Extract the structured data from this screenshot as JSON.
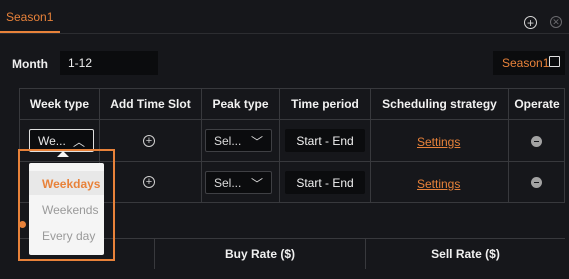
{
  "header": {
    "tab_label": "Season1"
  },
  "month": {
    "label": "Month",
    "value": "1-12"
  },
  "season_button": {
    "label": "Season1"
  },
  "table": {
    "columns": [
      "Week type",
      "Add Time Slot",
      "Peak type",
      "Time period",
      "Scheduling strategy",
      "Operate"
    ],
    "rows": [
      {
        "week_type": "We...",
        "peak_type": "Sel...",
        "time_period": "Start - End",
        "strategy": "Settings"
      },
      {
        "peak_type": "Sel...",
        "time_period": "Start - End",
        "strategy": "Settings"
      }
    ]
  },
  "dropdown": {
    "options": [
      "Weekdays",
      "Weekends",
      "Every day"
    ],
    "selected": "Weekdays"
  },
  "rates": {
    "buy_label": "Buy Rate ($)",
    "sell_label": "Sell Rate ($)"
  },
  "colors": {
    "accent": "#e8823a",
    "background": "#16171b",
    "field": "#0b0c0e"
  }
}
